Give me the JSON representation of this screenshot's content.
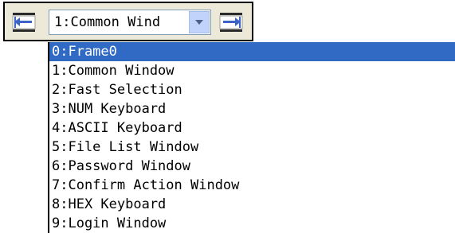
{
  "toolbar": {
    "prev_icon": "arrow-left-icon",
    "next_icon": "arrow-right-icon",
    "combo_value": "1:Common Wind",
    "dropdown_icon": "chevron-down-icon"
  },
  "dropdown": {
    "selected_index": 0,
    "items": [
      "0:Frame0",
      "1:Common Window",
      "2:Fast Selection",
      "3:NUM Keyboard",
      "4:ASCII Keyboard",
      "5:File List Window",
      "6:Password Window",
      "7:Confirm Action Window",
      "8:HEX Keyboard",
      "9:Login Window"
    ]
  },
  "colors": {
    "selection": "#316ac5",
    "toolbar_bg": "#ece9d8",
    "combo_arrow_bg": "#c1d3fb"
  }
}
